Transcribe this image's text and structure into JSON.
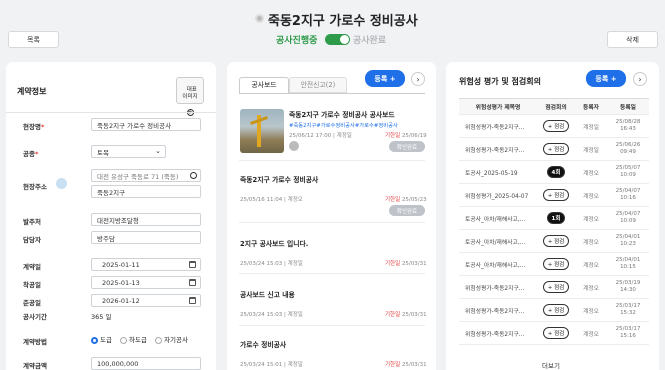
{
  "page": {
    "title": "죽동2지구 가로수 정비공사",
    "list_btn": "목록",
    "delete_btn": "삭제",
    "status_active": "공사진행중",
    "status_done": "공사완료"
  },
  "contract": {
    "title": "계약정보",
    "photo_btn": "대표\n이미지",
    "fields": {
      "site_label": "현장명",
      "site_value": "죽동2지구 가로수 정비공사",
      "type_label": "공종",
      "type_value": "토목",
      "addr_label": "현장주소",
      "addr_value": "대전 유성구 죽동로 71 (죽동)",
      "addr_detail": "죽동2지구",
      "orderer_label": "발주처",
      "orderer_value": "대전지방조달청",
      "manager_label": "담당자",
      "manager_value": "방주담",
      "contract_date_label": "계약일",
      "contract_date_value": "2025-01-11",
      "start_date_label": "착공일",
      "start_date_value": "2025-01-13",
      "end_date_label": "준공일",
      "end_date_value": "2026-01-12",
      "period_label": "공사기간",
      "period_value": "365 일",
      "method_label": "계약방법",
      "method_opts": [
        "도급",
        "하도급",
        "자기공사"
      ],
      "amount_label": "계약금액",
      "amount_value": "100,000,000"
    }
  },
  "board": {
    "tab_active": "공사보드",
    "tab_other": "안전신고(2)",
    "register": "등록 +",
    "arrow": "›",
    "posts": [
      {
        "title": "죽동2지구 가로수 정비공사 공사보드",
        "tags": "#죽동2지구#가로수정비공사#가로수#정비공사",
        "meta": "25/06/12 17:00 | 계정일",
        "due_k": "기한일",
        "due": "25/06/19",
        "status": "확인완료"
      },
      {
        "title": "죽동2지구 가로수 정비공사",
        "meta": "25/05/16 11:04 | 계정오",
        "due_k": "기한일",
        "due": "25/05/23",
        "status": "확인완료"
      },
      {
        "title": "2지구 공사보드 입니다.",
        "meta": "25/03/24 15:03 | 계정일",
        "due_k": "기한일",
        "due": "25/03/31"
      },
      {
        "title": "공사보드 신고 내용",
        "meta": "25/03/24 15:03 | 계정일",
        "due_k": "기한일",
        "due": "25/03/31"
      },
      {
        "title": "가로수 정비공사",
        "meta": "25/03/24 15:01 | 계정일",
        "due_k": "기한일",
        "due": "25/03/31"
      }
    ]
  },
  "risk": {
    "title": "위험성 평가 및 점검회의",
    "register": "등록 +",
    "arrow": "›",
    "cols": [
      "위험성평가 제목명",
      "점검회의",
      "등록자",
      "등록일"
    ],
    "rows": [
      {
        "name": "위험성평가-죽동2지구...",
        "badge": "+ 점검",
        "dark": false,
        "user": "계정일",
        "date": "25/08/28 16:43"
      },
      {
        "name": "위험성평가-죽동2지구...",
        "badge": "+ 점검",
        "dark": false,
        "user": "계정일",
        "date": "25/06/26 09:49"
      },
      {
        "name": "토공사_2025-05-19",
        "badge": "4회",
        "dark": true,
        "user": "계정오",
        "date": "25/05/07 10:09"
      },
      {
        "name": "위험성평가_2025-04-07",
        "badge": "+ 점검",
        "dark": false,
        "user": "계정오",
        "date": "25/04/07 10:16"
      },
      {
        "name": "토공사_아차/재해사고,...",
        "badge": "1회",
        "dark": true,
        "user": "계정오",
        "date": "25/04/07 10:09"
      },
      {
        "name": "토공사_아차/재해사고,...",
        "badge": "+ 점검",
        "dark": false,
        "user": "계정오",
        "date": "25/04/01 10:23"
      },
      {
        "name": "토공사_아차/재해사고,...",
        "badge": "+ 점검",
        "dark": false,
        "user": "계정오",
        "date": "25/04/01 10:15"
      },
      {
        "name": "위험성평가-죽동2지구...",
        "badge": "+ 점검",
        "dark": false,
        "user": "계정오",
        "date": "25/03/19 14:30"
      },
      {
        "name": "위험성평가-죽동2지구...",
        "badge": "+ 점검",
        "dark": false,
        "user": "계정오",
        "date": "25/03/17 15:32"
      },
      {
        "name": "위험성평가-죽동2지구...",
        "badge": "+ 점검",
        "dark": false,
        "user": "계정오",
        "date": "25/03/17 15:16"
      }
    ],
    "more": "더보기"
  }
}
